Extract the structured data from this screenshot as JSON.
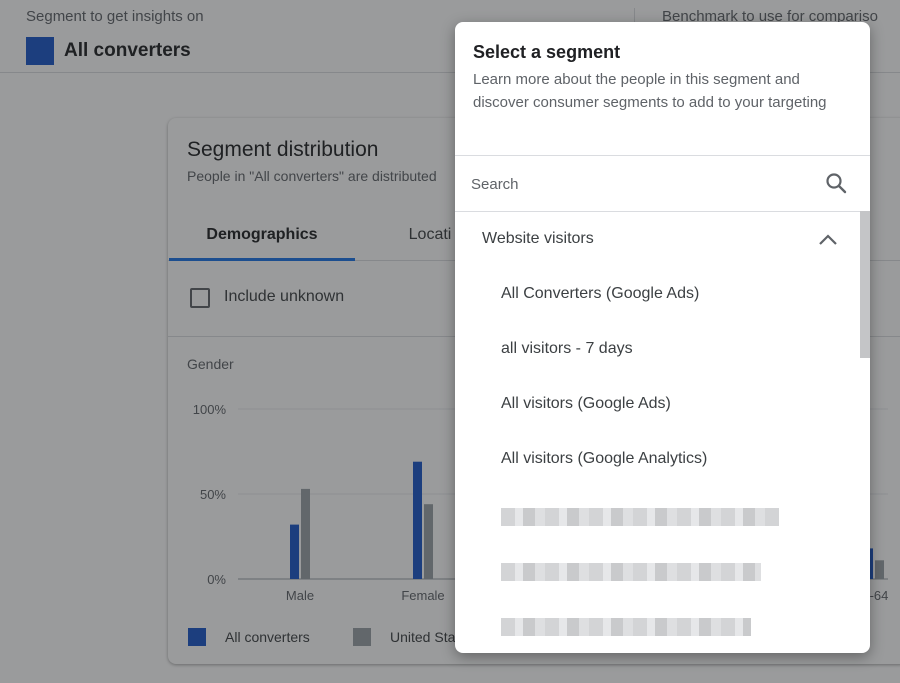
{
  "top_bar": {
    "segment_label": "Segment to get insights on",
    "segment_name": "All converters",
    "benchmark_label": "Benchmark to use for compariso"
  },
  "card": {
    "title": "Segment distribution",
    "subtitle": "People in \"All converters\" are distributed",
    "tabs": [
      {
        "label": "Demographics",
        "active": true
      },
      {
        "label": "Locati",
        "active": false
      }
    ],
    "include_unknown_label": "Include unknown"
  },
  "chart_data": {
    "type": "bar",
    "title": "Gender",
    "categories": [
      "Male",
      "Female"
    ],
    "partial_right_category_label": "-64",
    "series": [
      {
        "name": "All converters",
        "color": "#1a56c8",
        "values": [
          32,
          69
        ]
      },
      {
        "name": "United Sta",
        "color": "#9aa0a6",
        "values": [
          53,
          44
        ]
      }
    ],
    "partial_right_values": [
      18,
      11
    ],
    "y_ticks": [
      "100%",
      "50%",
      "0%"
    ],
    "ylim": [
      0,
      100
    ],
    "grid": true,
    "legend_position": "bottom-left"
  },
  "modal": {
    "title": "Select a segment",
    "description": "Learn more about the people in this segment and discover consumer segments to add to your targeting",
    "search": {
      "placeholder": "Search",
      "value": ""
    },
    "group": {
      "label": "Website visitors",
      "expanded": true,
      "items": [
        {
          "label": "All Converters (Google Ads)"
        },
        {
          "label": "all visitors - 7 days"
        },
        {
          "label": "All visitors (Google Ads)"
        },
        {
          "label": "All visitors (Google Analytics)"
        }
      ],
      "redacted_item_count": 3
    }
  },
  "colors": {
    "accent": "#1a73e8",
    "series_blue": "#1a56c8",
    "series_gray": "#9aa0a6",
    "scrim": "rgba(32,33,36,0.45)"
  },
  "icons": {
    "search": "search-icon",
    "chevron": "chevron-up-icon",
    "checkbox": "checkbox-unchecked-icon"
  }
}
